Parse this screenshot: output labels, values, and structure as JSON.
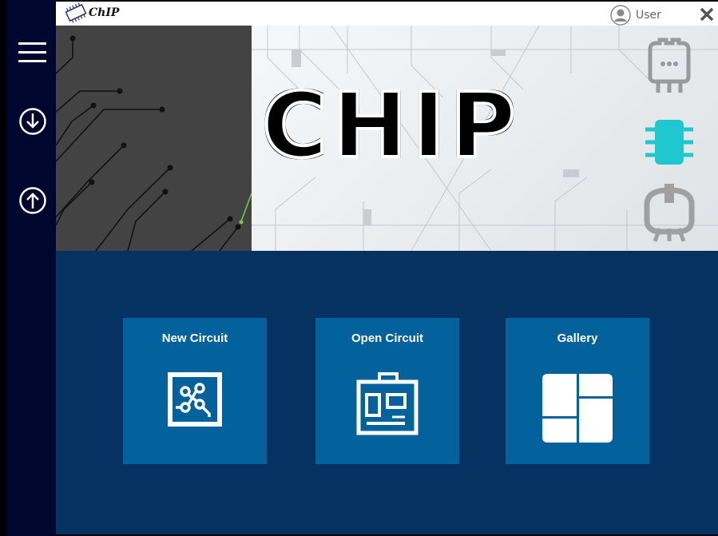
{
  "window": {
    "title": "ChIP",
    "user_label": "User"
  },
  "sidebar": {
    "items": [
      {
        "name": "menu",
        "icon": "hamburger-menu-icon"
      },
      {
        "name": "download",
        "icon": "download-icon"
      },
      {
        "name": "upload",
        "icon": "upload-icon"
      }
    ]
  },
  "banner": {
    "headline": "CHIP"
  },
  "right_toolbar": {
    "items": [
      {
        "name": "chip-outline",
        "icon": "chip-outline-icon",
        "active": false
      },
      {
        "name": "chip-active",
        "icon": "chip-icon",
        "active": true
      },
      {
        "name": "socket",
        "icon": "socket-icon",
        "active": false
      }
    ]
  },
  "tiles": [
    {
      "label": "New Circuit",
      "icon": "circuit-board-icon"
    },
    {
      "label": "Open Circuit",
      "icon": "pcb-open-icon"
    },
    {
      "label": "Gallery",
      "icon": "gallery-grid-icon"
    }
  ],
  "colors": {
    "sidebar": "#00062e",
    "content_bg": "#063261",
    "tile_bg": "#03619b",
    "accent_cyan": "#1fc8cf"
  }
}
